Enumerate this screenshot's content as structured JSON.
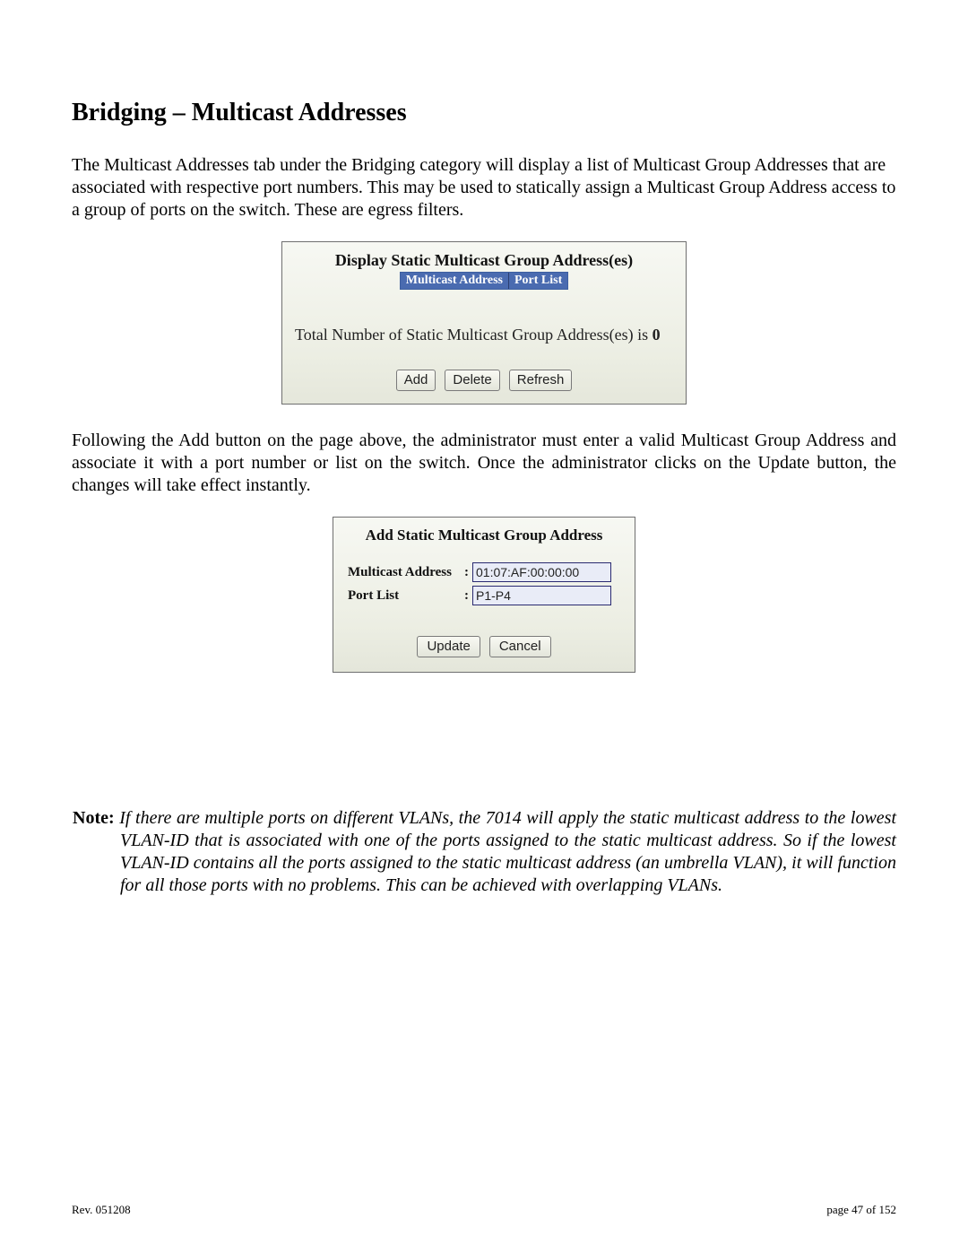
{
  "heading": "Bridging – Multicast Addresses",
  "para1": "The Multicast Addresses tab under the Bridging category will display a list of Multicast Group Addresses that are associated with respective port numbers.  This may be used to statically assign a Multicast Group Address access to a group of ports on the switch.  These are egress filters.",
  "panel1": {
    "title": "Display Static Multicast Group Address(es)",
    "headers": [
      "Multicast Address",
      "Port List"
    ],
    "total_prefix": "Total Number of Static Multicast Group Address(es) is ",
    "total_count": "0",
    "buttons": {
      "add": "Add",
      "delete": "Delete",
      "refresh": "Refresh"
    }
  },
  "para2": "Following the Add button on the page above, the administrator must enter a valid Multicast Group Address and associate it with a port number or list on the switch.  Once the administrator clicks on the Update button, the changes will take effect instantly.",
  "panel2": {
    "title": "Add Static Multicast Group Address",
    "rows": {
      "multicast_label": "Multicast Address",
      "multicast_value": "01:07:AF:00:00:00",
      "portlist_label": "Port List",
      "portlist_value": "P1-P4"
    },
    "buttons": {
      "update": "Update",
      "cancel": "Cancel"
    }
  },
  "note": {
    "label": "Note: ",
    "body": "If there are multiple ports on different VLANs, the 7014 will apply the static multicast address to the lowest VLAN-ID that is associated with one of the ports assigned to the static multicast address.  So if the lowest VLAN-ID contains all the ports assigned to the static multicast address (an umbrella VLAN), it will function for all those ports with no problems.  This can be achieved with overlapping VLANs."
  },
  "footer": {
    "left": "Rev.  051208",
    "right": "page 47 of 152"
  }
}
